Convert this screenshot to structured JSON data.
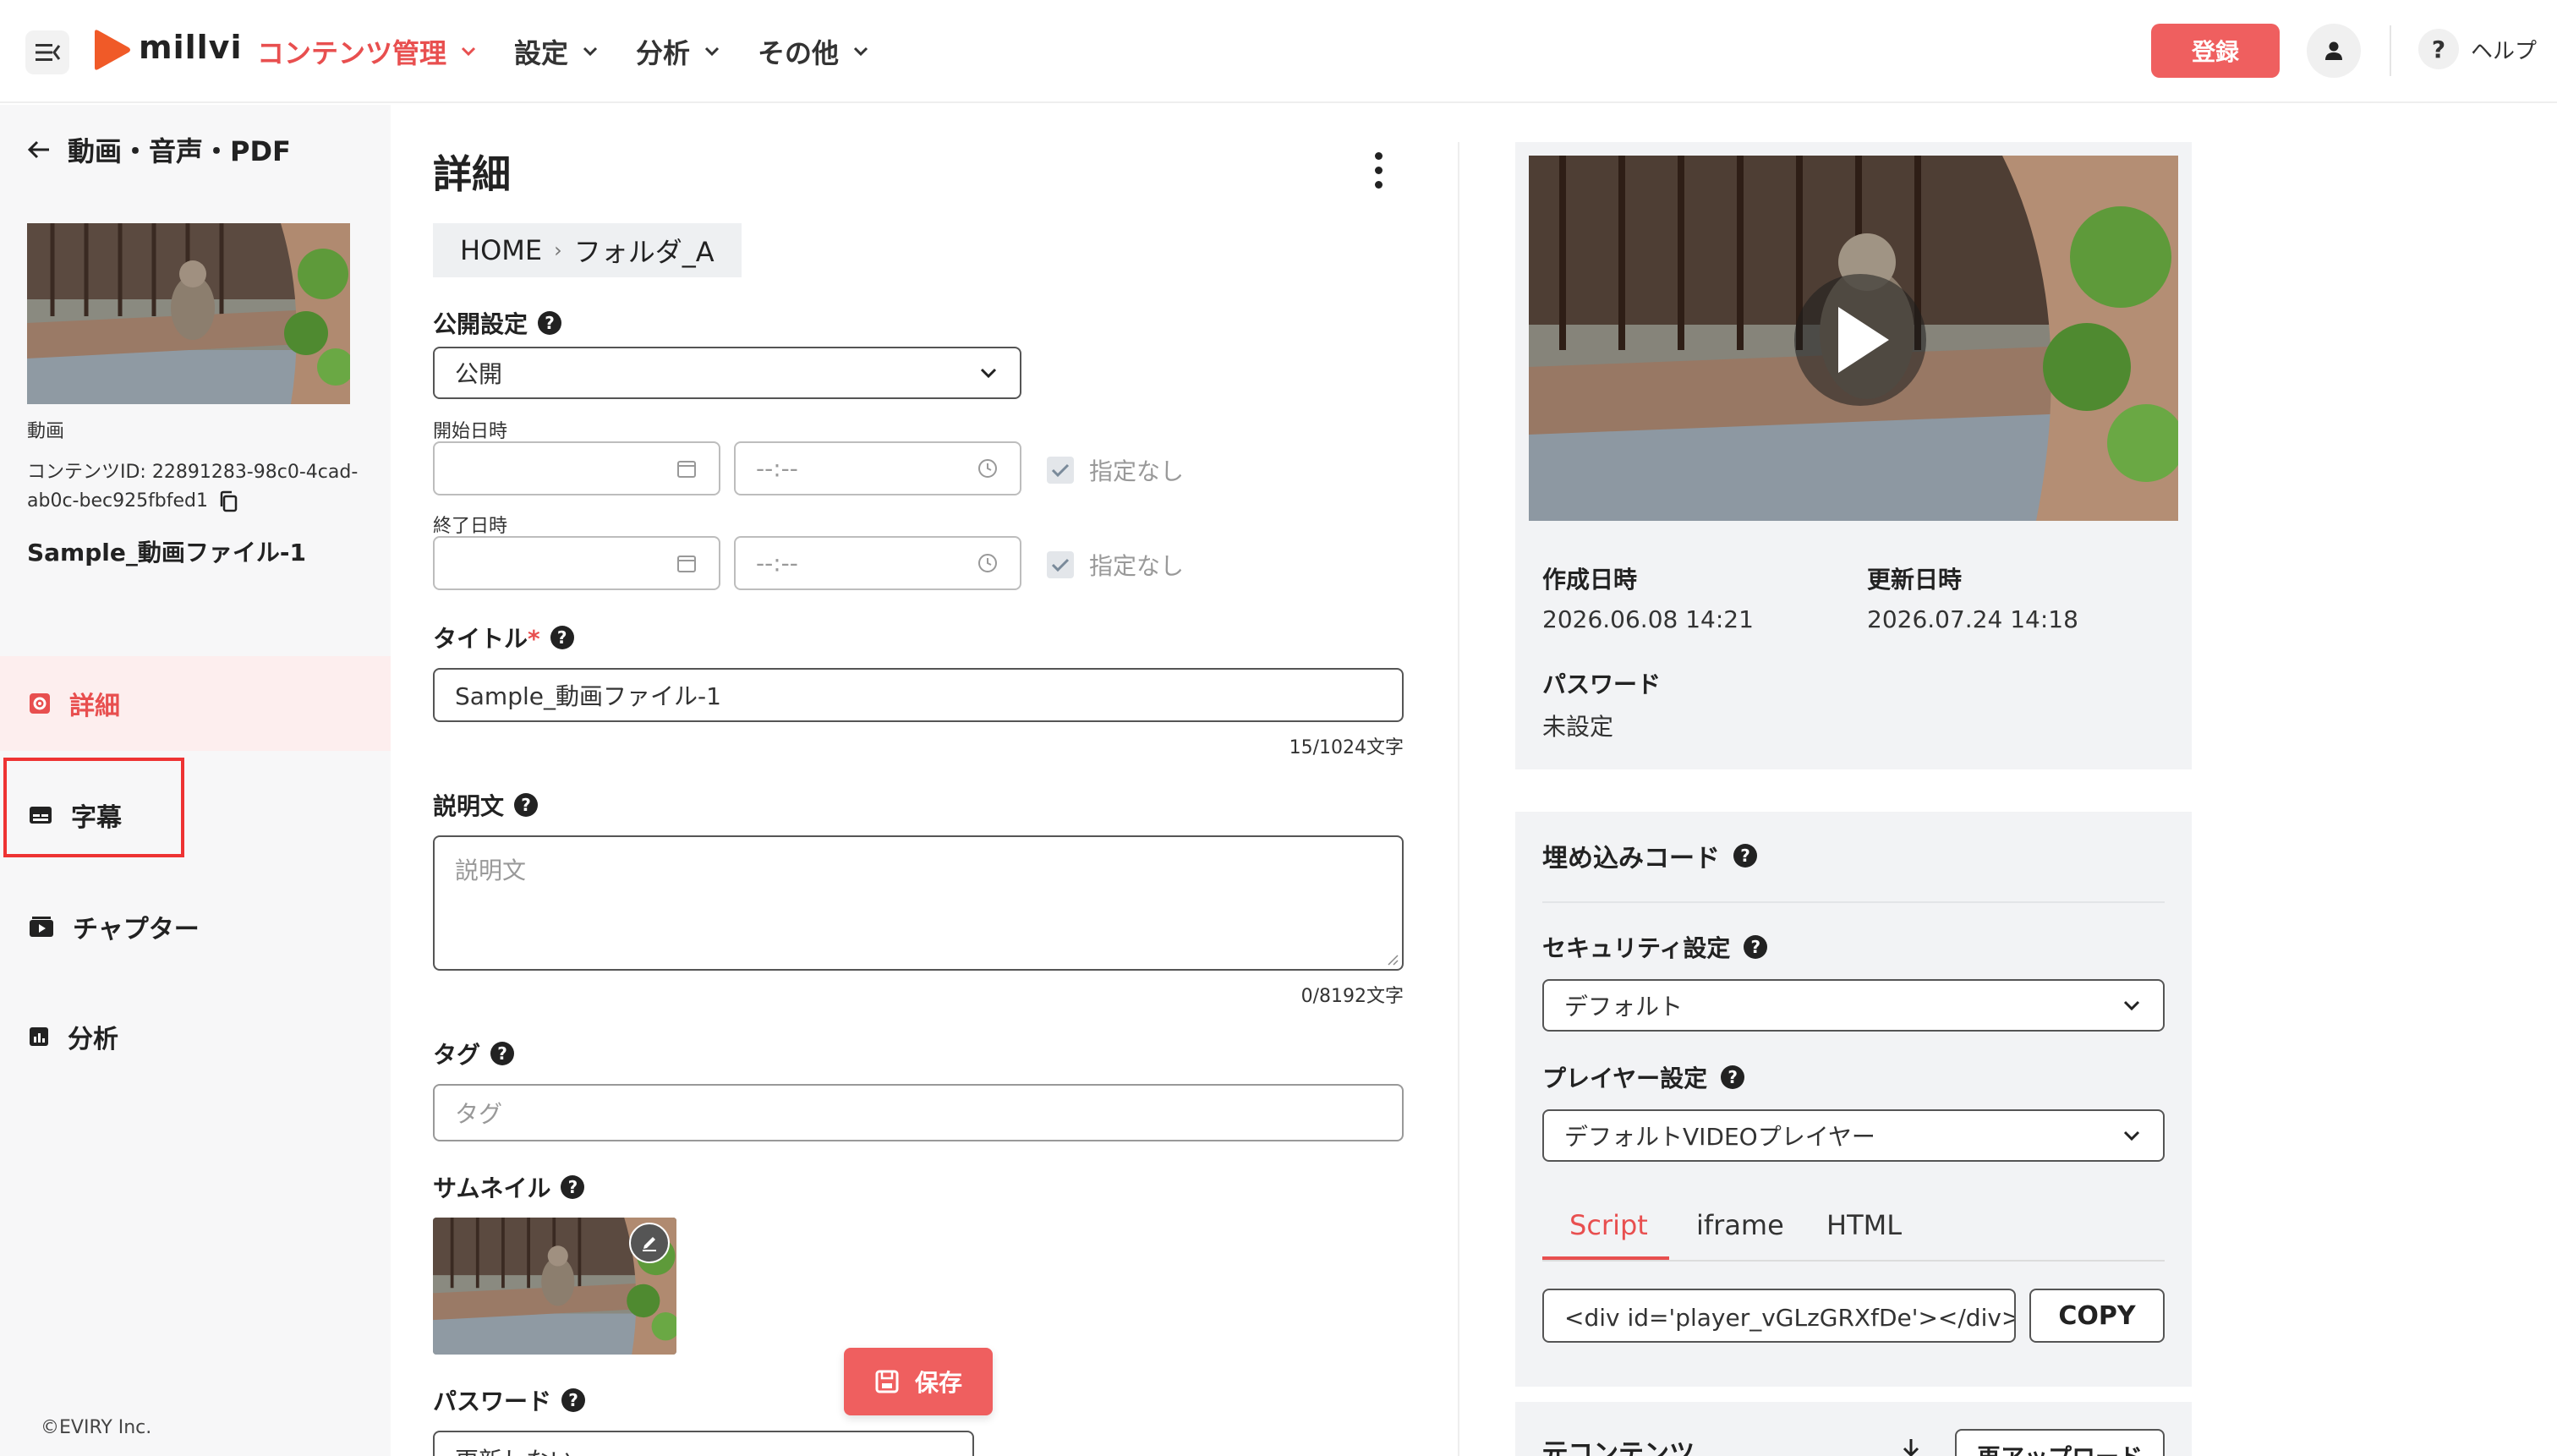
{
  "header": {
    "logo_text": "millvi",
    "nav": [
      {
        "label": "コンテンツ管理"
      },
      {
        "label": "設定"
      },
      {
        "label": "分析"
      },
      {
        "label": "その他"
      }
    ],
    "register_label": "登録",
    "help_symbol": "?",
    "help_label": "ヘルプ"
  },
  "sidebar": {
    "back_label": "動画・音声・PDF",
    "content_type": "動画",
    "content_id_line1": "コンテンツID: 22891283-98c0-4cad-",
    "content_id_line2": "ab0c-bec925fbfed1",
    "content_name": "Sample_動画ファイル-1",
    "items": [
      {
        "label": "詳細"
      },
      {
        "label": "字幕"
      },
      {
        "label": "チャプター"
      },
      {
        "label": "分析"
      }
    ],
    "copyright": "©EVIRY Inc."
  },
  "main": {
    "title": "詳細",
    "breadcrumb": {
      "home": "HOME",
      "sep": "›",
      "folder": "フォルダ_A"
    },
    "visibility": {
      "label": "公開設定",
      "value": "公開"
    },
    "start": {
      "label": "開始日時",
      "time_placeholder": "--:--",
      "none_label": "指定なし"
    },
    "end": {
      "label": "終了日時",
      "time_placeholder": "--:--",
      "none_label": "指定なし"
    },
    "title_field": {
      "label": "タイトル",
      "required_mark": "*",
      "value": "Sample_動画ファイル-1",
      "counter": "15/1024文字"
    },
    "description": {
      "label": "説明文",
      "placeholder": "説明文",
      "counter": "0/8192文字"
    },
    "tags": {
      "label": "タグ",
      "placeholder": "タグ"
    },
    "thumbnail": {
      "label": "サムネイル"
    },
    "password": {
      "label": "パスワード",
      "value": "更新しない"
    },
    "save_label": "保存"
  },
  "preview": {
    "created_label": "作成日時",
    "created_value": "2026.06.08 14:21",
    "updated_label": "更新日時",
    "updated_value": "2026.07.24 14:18",
    "password_label": "パスワード",
    "password_value": "未設定"
  },
  "embed": {
    "title": "埋め込みコード",
    "security_label": "セキュリティ設定",
    "security_value": "デフォルト",
    "player_label": "プレイヤー設定",
    "player_value": "デフォルトVIDEOプレイヤー",
    "tabs": [
      {
        "label": "Script"
      },
      {
        "label": "iframe"
      },
      {
        "label": "HTML"
      }
    ],
    "code": "<div id='player_vGLzGRXfDe'></div> <",
    "copy_label": "COPY"
  },
  "source": {
    "title": "元コンテンツ",
    "reupload_label": "再アップロード"
  },
  "colors": {
    "accent": "#e84f4f",
    "button": "#ef5f5f",
    "panel_bg": "#f2f3f5",
    "sidebar_bg": "#f7f7f8",
    "highlight_box": "#ee3333"
  },
  "icons": [
    "menu-collapse-icon",
    "play-logo-icon",
    "chevron-down-icon",
    "user-icon",
    "help-icon",
    "arrow-left-icon",
    "copy-icon",
    "calendar-icon",
    "clock-icon",
    "check-icon",
    "gear-icon",
    "subtitle-icon",
    "chapter-icon",
    "analytics-icon",
    "pencil-icon",
    "save-icon",
    "play-icon",
    "download-icon"
  ]
}
